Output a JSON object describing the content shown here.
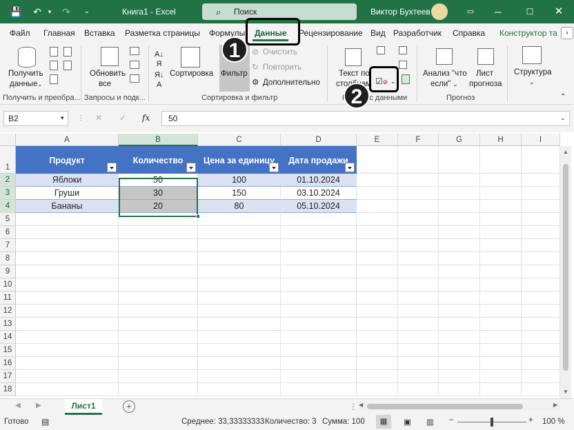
{
  "window": {
    "title": "Книга1 - Excel",
    "user": "Виктор Бухтеев",
    "search_placeholder": "Поиск"
  },
  "tabs": [
    "Файл",
    "Главная",
    "Вставка",
    "Разметка страницы",
    "Формулы",
    "Данные",
    "Рецензирование",
    "Вид",
    "Разработчик",
    "Справка",
    "Конструктор та"
  ],
  "ribbon": {
    "get_data_l1": "Получить",
    "get_data_l2": "данные",
    "get_group": "Получить и преобра...",
    "refresh_l1": "Обновить",
    "refresh_l2": "все",
    "queries_group": "Запросы и подк...",
    "sort": "Сортировка",
    "filter": "Фильтр",
    "clear": "Очистить",
    "reapply": "Повторить",
    "advanced": "Дополнительно",
    "sort_group": "Сортировка и фильтр",
    "text_cols_l1": "Текст по",
    "text_cols_l2": "столбцам",
    "tools_group": "Работа с данными",
    "whatif_l1": "Анализ \"что",
    "whatif_l2": "если\"",
    "forecast_l1": "Лист",
    "forecast_l2": "прогноза",
    "forecast_group": "Прогноз",
    "outline": "Структура"
  },
  "formula_bar": {
    "name_box": "B2",
    "fx": "fx",
    "value": "50"
  },
  "columns": [
    "A",
    "B",
    "C",
    "D",
    "E",
    "F",
    "G",
    "H",
    "I"
  ],
  "rows": [
    "1",
    "2",
    "3",
    "4",
    "5",
    "6",
    "7",
    "8",
    "9",
    "10",
    "11",
    "12",
    "13",
    "14",
    "15",
    "16",
    "17",
    "18"
  ],
  "table": {
    "headers": [
      "Продукт",
      "Количество",
      "Цена за единицу",
      "Дата продажи"
    ],
    "data": [
      [
        "Яблоки",
        "50",
        "100",
        "01.10.2024"
      ],
      [
        "Груши",
        "30",
        "150",
        "03.10.2024"
      ],
      [
        "Бананы",
        "20",
        "80",
        "05.10.2024"
      ]
    ]
  },
  "sheet_tab": "Лист1",
  "status": {
    "ready": "Готово",
    "average": "Среднее: 33,33333333",
    "count": "Количество: 3",
    "sum": "Сумма: 100",
    "zoom": "100 %"
  },
  "callouts": [
    "1",
    "2"
  ]
}
